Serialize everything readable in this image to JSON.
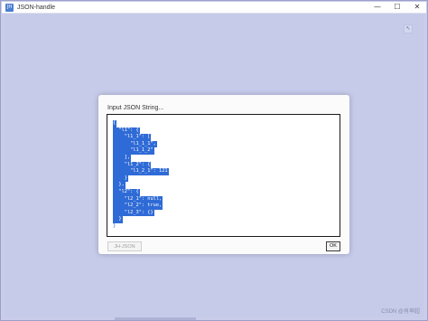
{
  "window": {
    "icon_text": "JH",
    "title": "JSON-handle",
    "controls": {
      "minimize": "—",
      "maximize": "☐",
      "close": "✕"
    }
  },
  "corner_button": {
    "icon": "arrow-icon",
    "glyph": "↖"
  },
  "dialog": {
    "title": "Input JSON String...",
    "code_lines": [
      "{",
      "  \"l1\": {",
      "    \"l1_1\": [",
      "      \"l1_1_1\",",
      "      \"l1_1_2\"",
      "    ],",
      "    \"l1_2\": {",
      "      \"l1_2_1\": 121",
      "    }",
      "  },",
      "  \"l2\": {",
      "    \"l2_1\": null,",
      "    \"l2_2\": true,",
      "    \"l2_3\": {}",
      "  }",
      "}"
    ],
    "json_button": "JH-JSON",
    "ok_button": "OK"
  },
  "watermark": "CSDN @肖坤超"
}
